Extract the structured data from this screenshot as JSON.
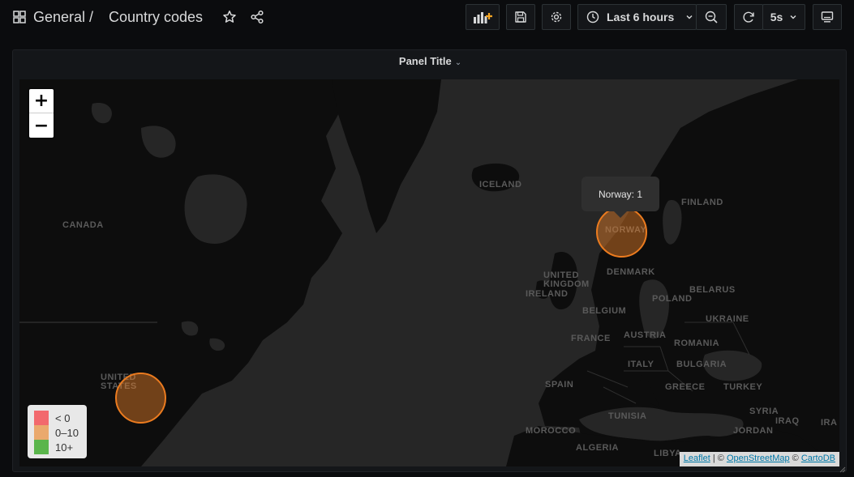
{
  "breadcrumb": {
    "folder": "General",
    "separator": "/",
    "dashboard": "Country codes"
  },
  "toolbar": {
    "icons": [
      "add-panel-icon",
      "save-icon",
      "settings-icon",
      "clock-icon",
      "zoom-out-icon",
      "refresh-icon",
      "tv-icon"
    ],
    "time_range": "Last 6 hours",
    "refresh_interval": "5s"
  },
  "panel": {
    "title": "Panel Title"
  },
  "map": {
    "labels": {
      "canada": "CANADA",
      "united_states": "UNITED\nSTATES",
      "iceland": "ICELAND",
      "finland": "FINLAND",
      "norway": "NORWAY",
      "denmark": "DENMARK",
      "united_kingdom": "UNITED\nKINGDOM",
      "ireland": "IRELAND",
      "belarus": "BELARUS",
      "poland": "POLAND",
      "belgium": "BELGIUM",
      "ukraine": "UKRAINE",
      "france": "FRANCE",
      "austria": "AUSTRIA",
      "romania": "ROMANIA",
      "italy": "ITALY",
      "bulgaria": "BULGARIA",
      "spain": "SPAIN",
      "greece": "GREECE",
      "turkey": "TURKEY",
      "tunisia": "TUNISIA",
      "syria": "SYRIA",
      "iraq": "IRAQ",
      "ira": "IRA",
      "morocco": "MOROCCO",
      "jordan": "JORDAN",
      "algeria": "ALGERIA",
      "libya": "LIBYA"
    },
    "zoom_in": "+",
    "zoom_out": "−",
    "tooltip": "Norway: 1",
    "marker_color": "#eb7b1f",
    "legend": [
      {
        "label": "< 0",
        "color": "#f2696d"
      },
      {
        "label": "0–10",
        "color": "#eaa96d"
      },
      {
        "label": "10+",
        "color": "#5ab54b"
      }
    ],
    "attribution": {
      "leaflet": "Leaflet",
      "sep1": " | © ",
      "osm": "OpenStreetMap",
      "sep2": " © ",
      "carto": "CartoDB"
    }
  }
}
